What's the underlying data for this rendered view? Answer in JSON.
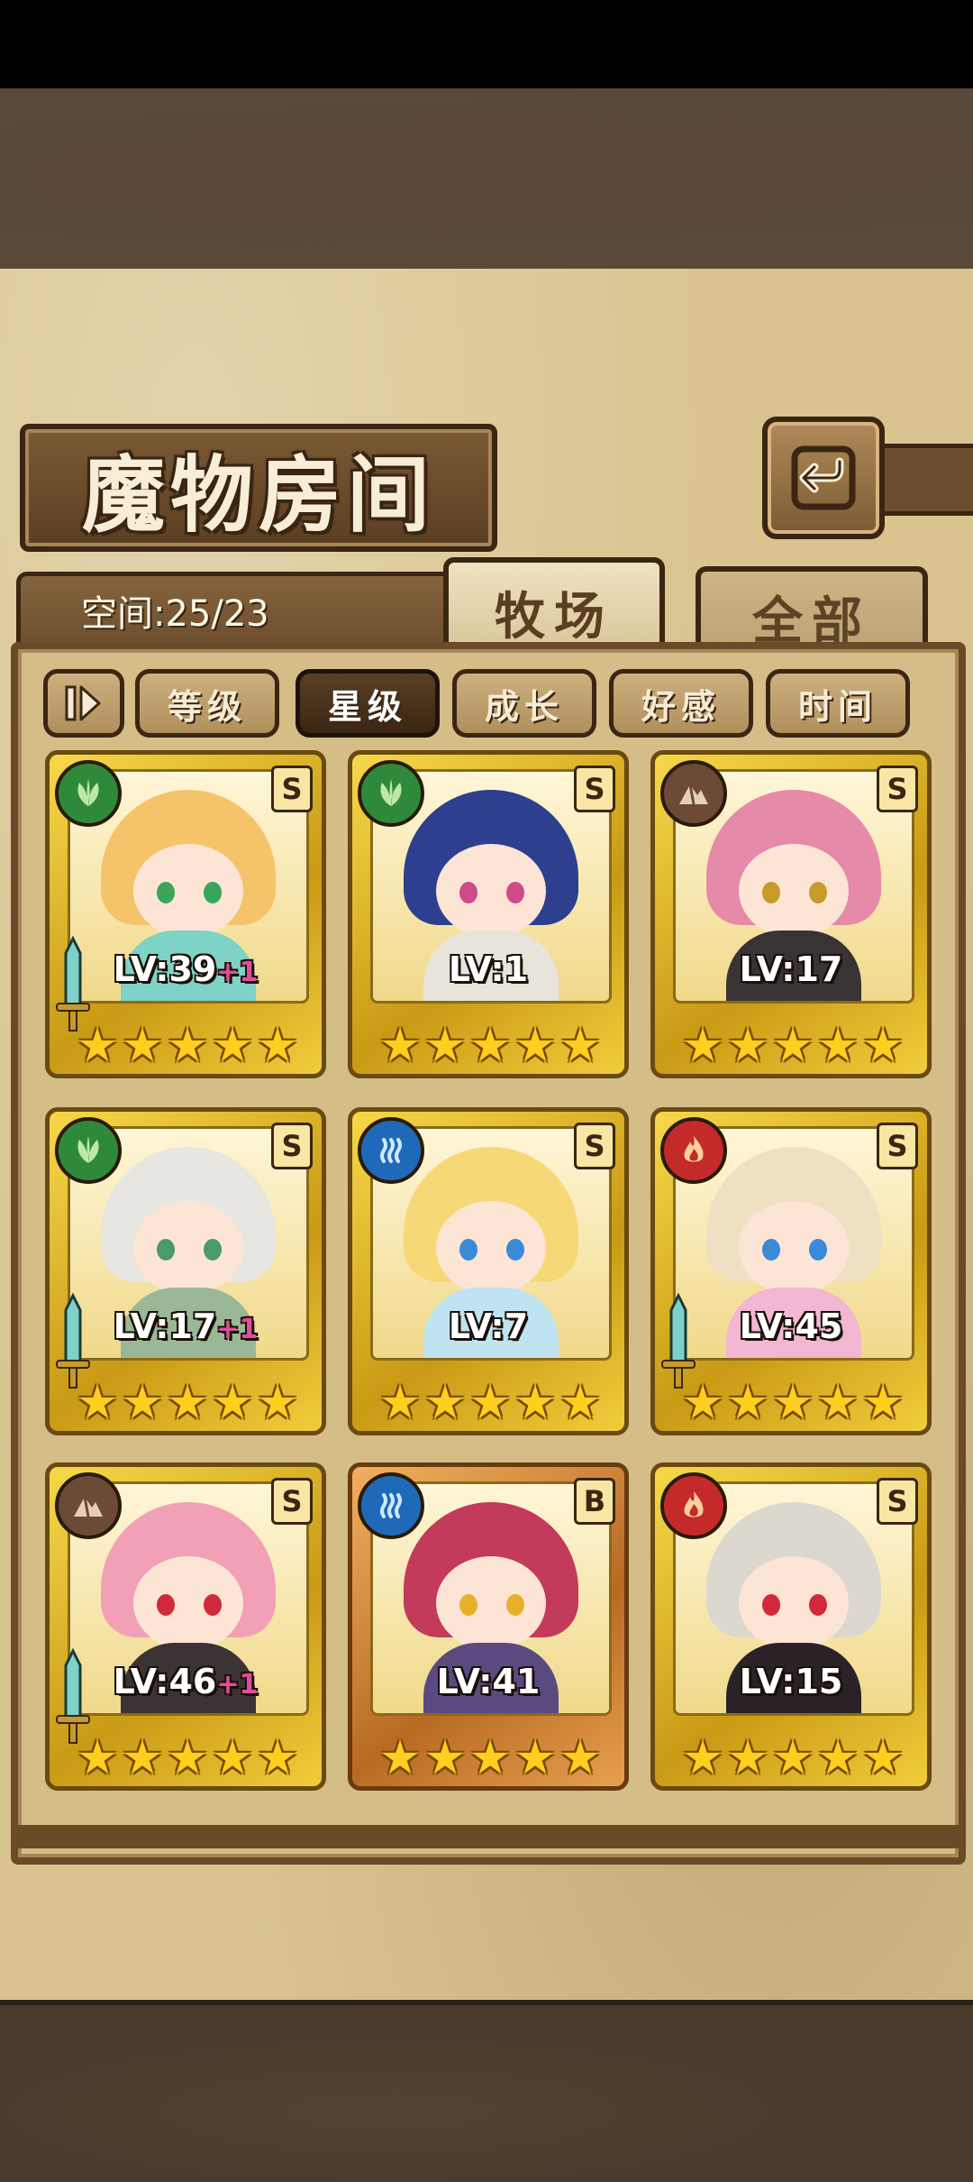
{
  "title": "魔物房间",
  "space_label": "空间:25/23",
  "tabs": [
    {
      "label": "牧场",
      "active": true
    },
    {
      "label": "全部",
      "active": false
    }
  ],
  "sort_buttons": [
    {
      "label": "等级",
      "active": false
    },
    {
      "label": "星级",
      "active": true
    },
    {
      "label": "成长",
      "active": false
    },
    {
      "label": "好感",
      "active": false
    },
    {
      "label": "时间",
      "active": false
    }
  ],
  "cards": [
    {
      "element": "leaf-icon",
      "element_color": "#2e8a3a",
      "rank": "S",
      "level": "LV:39",
      "bonus": "+1",
      "stars": 5,
      "has_sword": true,
      "frame": "gold",
      "hair": "#f5c46a",
      "outfit": "#7dd3c5",
      "eye": "#3aa55a"
    },
    {
      "element": "leaf-icon",
      "element_color": "#2e8a3a",
      "rank": "S",
      "level": "LV:1",
      "bonus": "",
      "stars": 5,
      "has_sword": false,
      "frame": "gold",
      "hair": "#2d3f8e",
      "outfit": "#e8e4dc",
      "eye": "#d04a8a"
    },
    {
      "element": "earth-icon",
      "element_color": "#6b4a36",
      "rank": "S",
      "level": "LV:17",
      "bonus": "",
      "stars": 5,
      "has_sword": false,
      "frame": "gold",
      "hair": "#e58aa8",
      "outfit": "#3a3336",
      "eye": "#c89a2a"
    },
    {
      "element": "leaf-icon",
      "element_color": "#2e8a3a",
      "rank": "S",
      "level": "LV:17",
      "bonus": "+1",
      "stars": 5,
      "has_sword": true,
      "frame": "gold",
      "hair": "#e8e6e0",
      "outfit": "#9ab896",
      "eye": "#4a9a6a"
    },
    {
      "element": "water-icon",
      "element_color": "#1f6ab8",
      "rank": "S",
      "level": "LV:7",
      "bonus": "",
      "stars": 5,
      "has_sword": false,
      "frame": "gold",
      "hair": "#f6d876",
      "outfit": "#bfe3f0",
      "eye": "#3a8ad8"
    },
    {
      "element": "fire-icon",
      "element_color": "#c42a2a",
      "rank": "S",
      "level": "LV:45",
      "bonus": "",
      "stars": 5,
      "has_sword": true,
      "frame": "gold",
      "hair": "#efe0c4",
      "outfit": "#f3b6d3",
      "eye": "#3a8ad8"
    },
    {
      "element": "earth-icon",
      "element_color": "#6b4a36",
      "rank": "S",
      "level": "LV:46",
      "bonus": "+1",
      "stars": 5,
      "has_sword": true,
      "frame": "gold",
      "hair": "#f2a0b6",
      "outfit": "#3c3434",
      "eye": "#d02a3a"
    },
    {
      "element": "water-icon",
      "element_color": "#1f6ab8",
      "rank": "B",
      "level": "LV:41",
      "bonus": "",
      "stars": 5,
      "has_sword": false,
      "frame": "bronze",
      "hair": "#c43a5a",
      "outfit": "#5a4a80",
      "eye": "#e8b02a"
    },
    {
      "element": "fire-icon",
      "element_color": "#c42a2a",
      "rank": "S",
      "level": "LV:15",
      "bonus": "",
      "stars": 5,
      "has_sword": false,
      "frame": "gold",
      "hair": "#dcd8d0",
      "outfit": "#2a2226",
      "eye": "#d02a3a"
    }
  ]
}
